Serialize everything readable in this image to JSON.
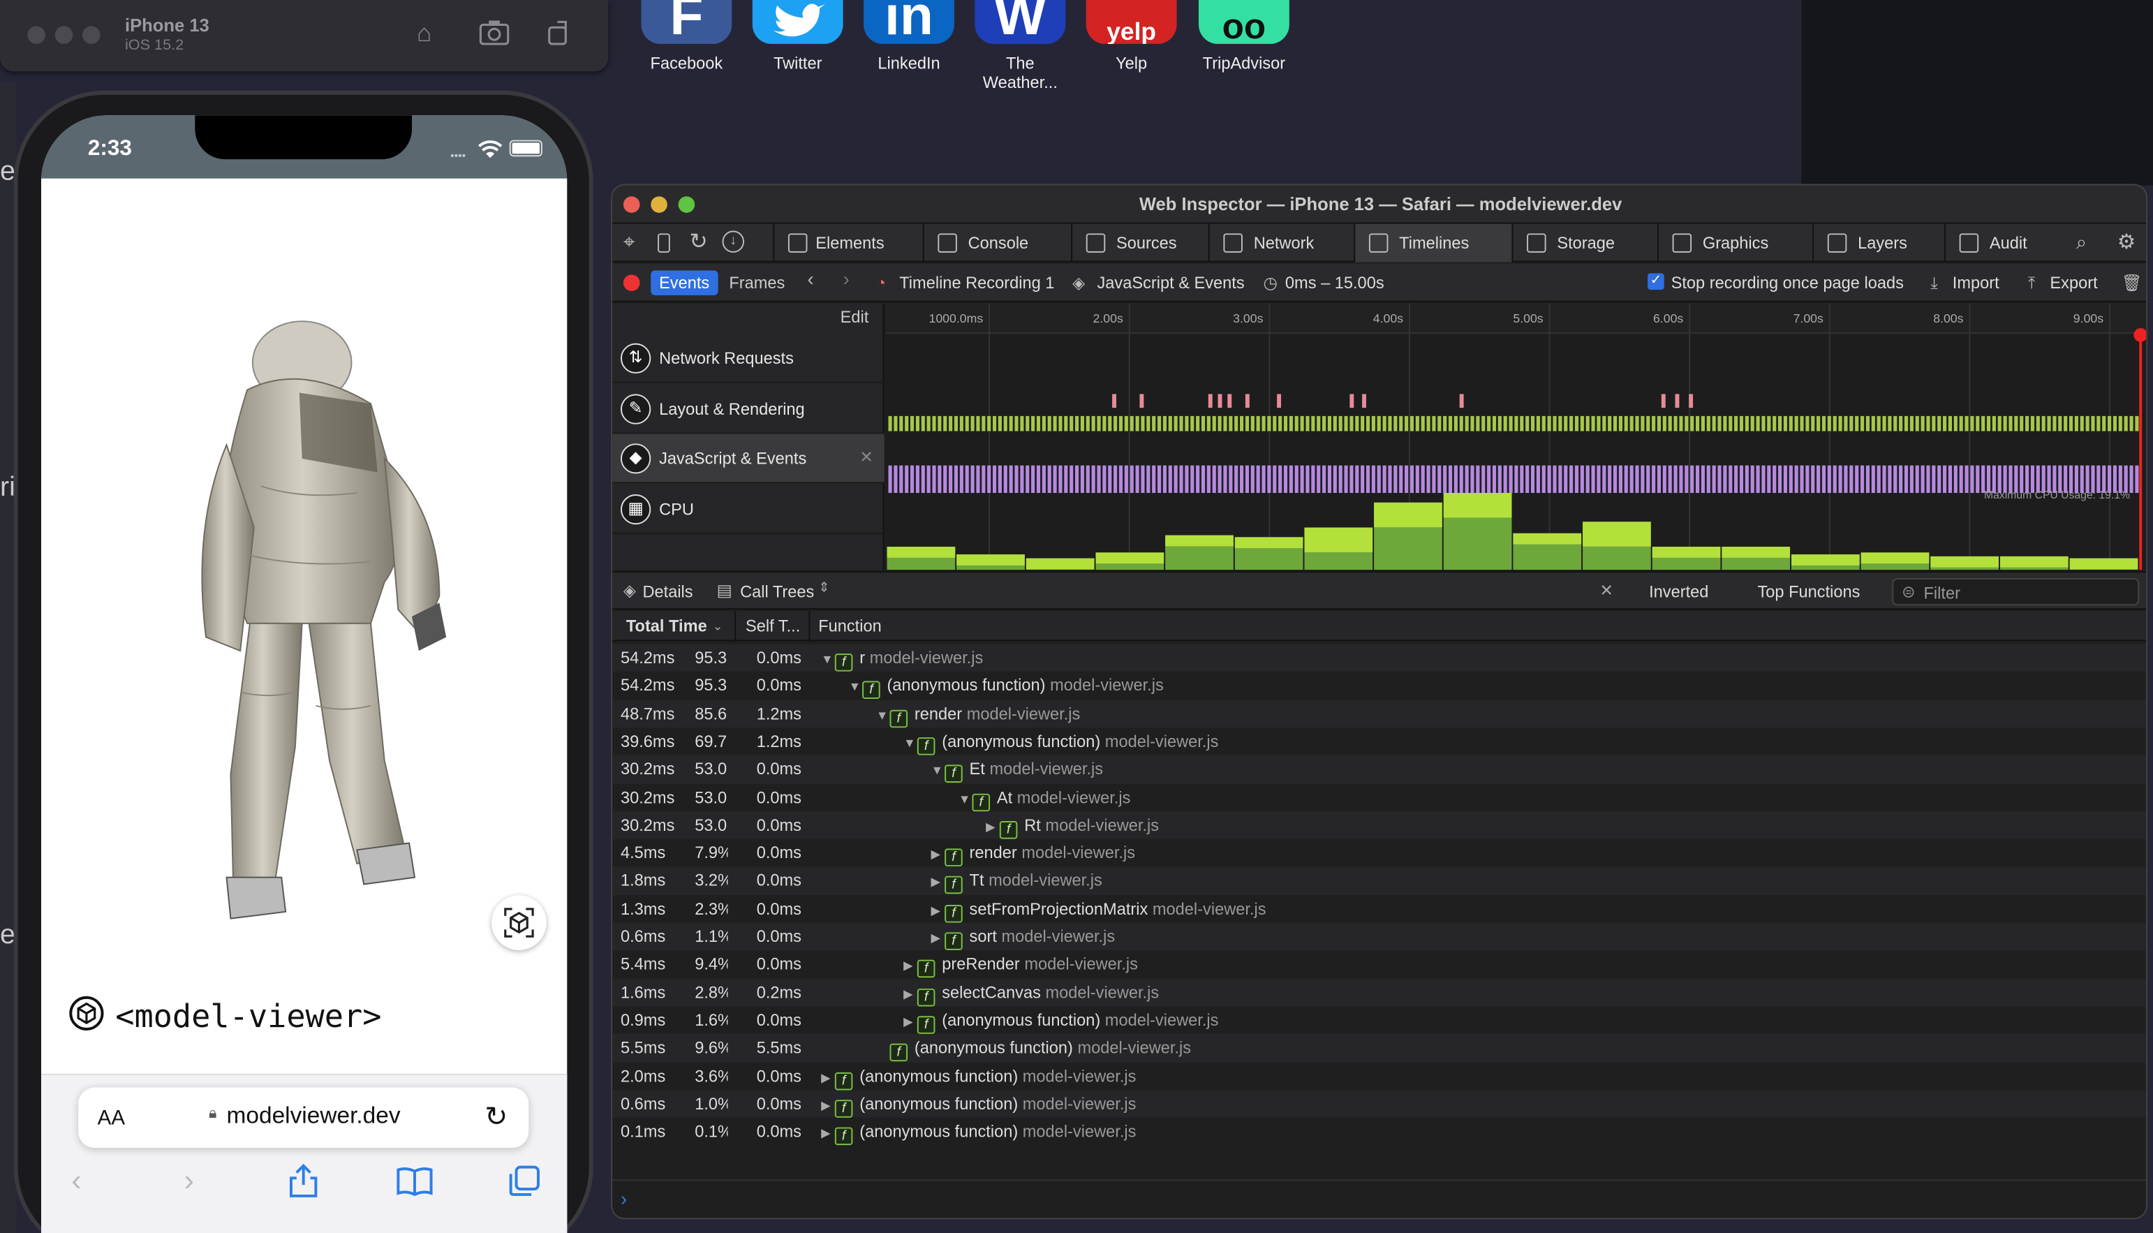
{
  "desktop": {
    "apps": [
      {
        "label": "Facebook",
        "glyph": "F",
        "color": "#3b5998"
      },
      {
        "label": "Twitter",
        "glyph": "",
        "color": "#1da1f2"
      },
      {
        "label": "LinkedIn",
        "glyph": "in",
        "color": "#0a66c2"
      },
      {
        "label": "The Weather...",
        "glyph": "W",
        "color": "#1f3fb8"
      },
      {
        "label": "Yelp",
        "glyph": "yelp",
        "color": "#d32323"
      },
      {
        "label": "TripAdvisor",
        "glyph": "oo",
        "color": "#34e0a1"
      }
    ]
  },
  "simulator": {
    "device": "iPhone 13",
    "os": "iOS 15.2"
  },
  "phone": {
    "time": "2:33",
    "page_title": "<model-viewer>",
    "text_size_button": "AA",
    "url": "modelviewer.dev"
  },
  "inspector": {
    "title": "Web Inspector — iPhone 13 — Safari — modelviewer.dev",
    "tabs": [
      "Elements",
      "Console",
      "Sources",
      "Network",
      "Timelines",
      "Storage",
      "Graphics",
      "Layers",
      "Audit"
    ],
    "selected_tab": "Timelines",
    "toolbar": {
      "events": "Events",
      "frames": "Frames",
      "recording": "Timeline Recording 1",
      "scope": "JavaScript & Events",
      "range": "0ms – 15.00s",
      "stop_label": "Stop recording once page loads",
      "import": "Import",
      "export": "Export"
    },
    "edit": "Edit",
    "overview_rows": [
      "Network Requests",
      "Layout & Rendering",
      "JavaScript & Events",
      "CPU"
    ],
    "ruler_ticks": [
      "1000.0ms",
      "2.00s",
      "3.00s",
      "4.00s",
      "5.00s",
      "6.00s",
      "7.00s",
      "8.00s",
      "9.00s"
    ],
    "cpu_label": "Maximum CPU Usage: 19.1%",
    "cpu_values": [
      12,
      8,
      6,
      9,
      18,
      17,
      22,
      35,
      40,
      19,
      25,
      12,
      12,
      8,
      9,
      7,
      7,
      6
    ],
    "details": {
      "details": "Details",
      "call_trees": "Call Trees",
      "inverted": "Inverted",
      "top_functions": "Top Functions",
      "filter_placeholder": "Filter"
    },
    "columns": [
      "Total Time",
      "Self T...",
      "Function"
    ],
    "rows": [
      {
        "total": "54.2ms",
        "pct": "95.3",
        "self": "0.0ms",
        "depth": 0,
        "open": true,
        "name": "r",
        "file": "model-viewer.js"
      },
      {
        "total": "54.2ms",
        "pct": "95.3",
        "self": "0.0ms",
        "depth": 1,
        "open": true,
        "name": "(anonymous function)",
        "file": "model-viewer.js"
      },
      {
        "total": "48.7ms",
        "pct": "85.6",
        "self": "1.2ms",
        "depth": 2,
        "open": true,
        "name": "render",
        "file": "model-viewer.js"
      },
      {
        "total": "39.6ms",
        "pct": "69.7",
        "self": "1.2ms",
        "depth": 3,
        "open": true,
        "name": "(anonymous function)",
        "file": "model-viewer.js"
      },
      {
        "total": "30.2ms",
        "pct": "53.0",
        "self": "0.0ms",
        "depth": 4,
        "open": true,
        "name": "Et",
        "file": "model-viewer.js"
      },
      {
        "total": "30.2ms",
        "pct": "53.0",
        "self": "0.0ms",
        "depth": 5,
        "open": true,
        "name": "At",
        "file": "model-viewer.js"
      },
      {
        "total": "30.2ms",
        "pct": "53.0",
        "self": "0.0ms",
        "depth": 6,
        "open": false,
        "name": "Rt",
        "file": "model-viewer.js"
      },
      {
        "total": "4.5ms",
        "pct": "7.9%",
        "self": "0.0ms",
        "depth": 4,
        "open": false,
        "name": "render",
        "file": "model-viewer.js"
      },
      {
        "total": "1.8ms",
        "pct": "3.2%",
        "self": "0.0ms",
        "depth": 4,
        "open": false,
        "name": "Tt",
        "file": "model-viewer.js"
      },
      {
        "total": "1.3ms",
        "pct": "2.3%",
        "self": "0.0ms",
        "depth": 4,
        "open": false,
        "name": "setFromProjectionMatrix",
        "file": "model-viewer.js"
      },
      {
        "total": "0.6ms",
        "pct": "1.1%",
        "self": "0.0ms",
        "depth": 4,
        "open": false,
        "name": "sort",
        "file": "model-viewer.js"
      },
      {
        "total": "5.4ms",
        "pct": "9.4%",
        "self": "0.0ms",
        "depth": 3,
        "open": false,
        "name": "preRender",
        "file": "model-viewer.js"
      },
      {
        "total": "1.6ms",
        "pct": "2.8%",
        "self": "0.2ms",
        "depth": 3,
        "open": false,
        "name": "selectCanvas",
        "file": "model-viewer.js"
      },
      {
        "total": "0.9ms",
        "pct": "1.6%",
        "self": "0.0ms",
        "depth": 3,
        "open": false,
        "name": "(anonymous function)",
        "file": "model-viewer.js"
      },
      {
        "total": "5.5ms",
        "pct": "9.6%",
        "self": "5.5ms",
        "depth": 2,
        "open": null,
        "name": "(anonymous function)",
        "file": "model-viewer.js"
      },
      {
        "total": "2.0ms",
        "pct": "3.6%",
        "self": "0.0ms",
        "depth": 0,
        "open": false,
        "name": "(anonymous function)",
        "file": "model-viewer.js"
      },
      {
        "total": "0.6ms",
        "pct": "1.0%",
        "self": "0.0ms",
        "depth": 0,
        "open": false,
        "name": "(anonymous function)",
        "file": "model-viewer.js"
      },
      {
        "total": "0.1ms",
        "pct": "0.1%",
        "self": "0.0ms",
        "depth": 0,
        "open": false,
        "name": "(anonymous function)",
        "file": "model-viewer.js"
      }
    ]
  }
}
